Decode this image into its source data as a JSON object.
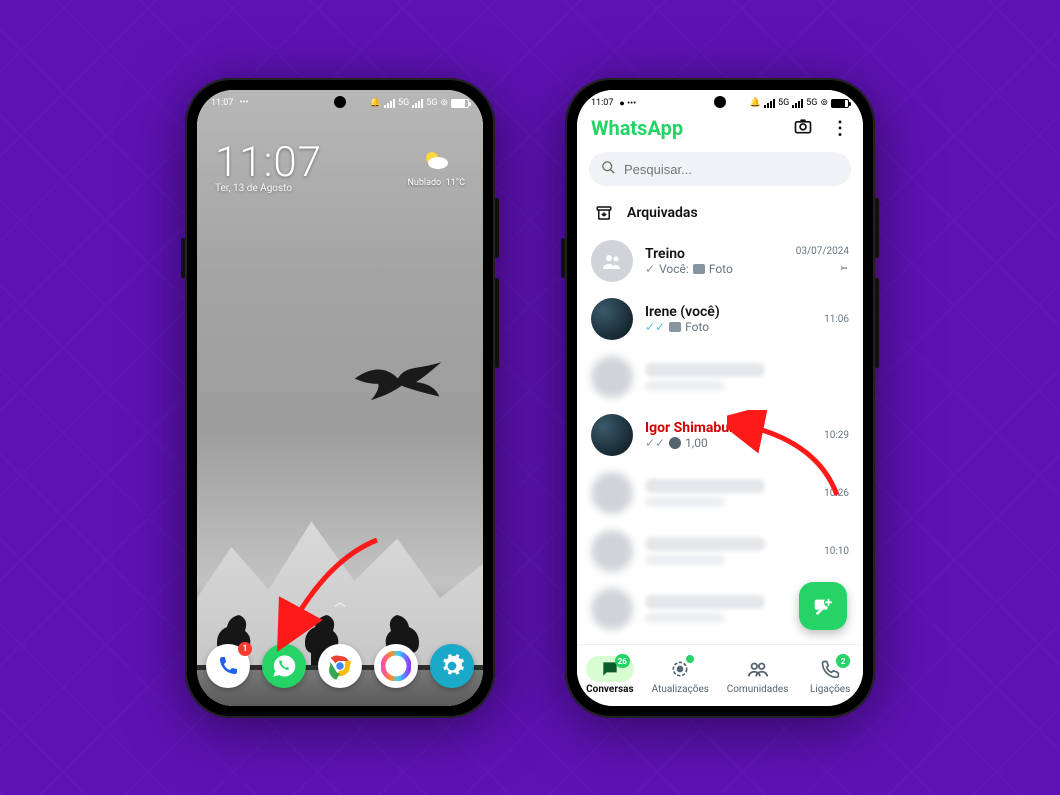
{
  "statusbar": {
    "time": "11:07",
    "net_label": "5G"
  },
  "home": {
    "clock": {
      "time": "11:07",
      "date": "Ter, 13 de Agosto"
    },
    "weather": {
      "condition": "Nublado",
      "temp": "11°C"
    },
    "dock": {
      "phone_badge": "1",
      "apps": [
        "phone",
        "whatsapp",
        "chrome",
        "gallery",
        "settings"
      ]
    }
  },
  "whatsapp": {
    "title": "WhatsApp",
    "search_placeholder": "Pesquisar...",
    "archived_label": "Arquivadas",
    "fab": "new-chat",
    "chats": [
      {
        "name": "Treino",
        "sub_prefix": "Você:",
        "sub_kind": "Foto",
        "time": "03/07/2024",
        "pinned": true,
        "avatar": "group",
        "blurred": false,
        "ticks": "single"
      },
      {
        "name": "Irene (você)",
        "sub_prefix": "",
        "sub_kind": "Foto",
        "time": "11:06",
        "pinned": false,
        "avatar": "img",
        "blurred": false,
        "ticks": "double_blue"
      },
      {
        "name": "",
        "sub_prefix": "",
        "sub_kind": "",
        "time": "",
        "pinned": false,
        "avatar": "blur",
        "blurred": true,
        "ticks": ""
      },
      {
        "name": "Igor Shimabukuro",
        "sub_prefix": "",
        "sub_kind": "1,00",
        "time": "10:29",
        "pinned": false,
        "avatar": "img",
        "blurred": false,
        "highlighted": true,
        "ticks": "double_grey",
        "money": true
      },
      {
        "name": "",
        "sub_prefix": "",
        "sub_kind": "",
        "time": "10:26",
        "pinned": false,
        "avatar": "blur",
        "blurred": true,
        "ticks": ""
      },
      {
        "name": "",
        "sub_prefix": "",
        "sub_kind": "",
        "time": "10:10",
        "pinned": false,
        "avatar": "blur",
        "blurred": true,
        "ticks": ""
      },
      {
        "name": "",
        "sub_prefix": "",
        "sub_kind": "",
        "time": "",
        "pinned": false,
        "avatar": "blur",
        "blurred": true,
        "ticks": ""
      }
    ],
    "nav": {
      "conversas": {
        "label": "Conversas",
        "badge": "26"
      },
      "atualizacoes": {
        "label": "Atualizações"
      },
      "comunidades": {
        "label": "Comunidades"
      },
      "ligacoes": {
        "label": "Ligações",
        "badge": "2"
      }
    }
  }
}
